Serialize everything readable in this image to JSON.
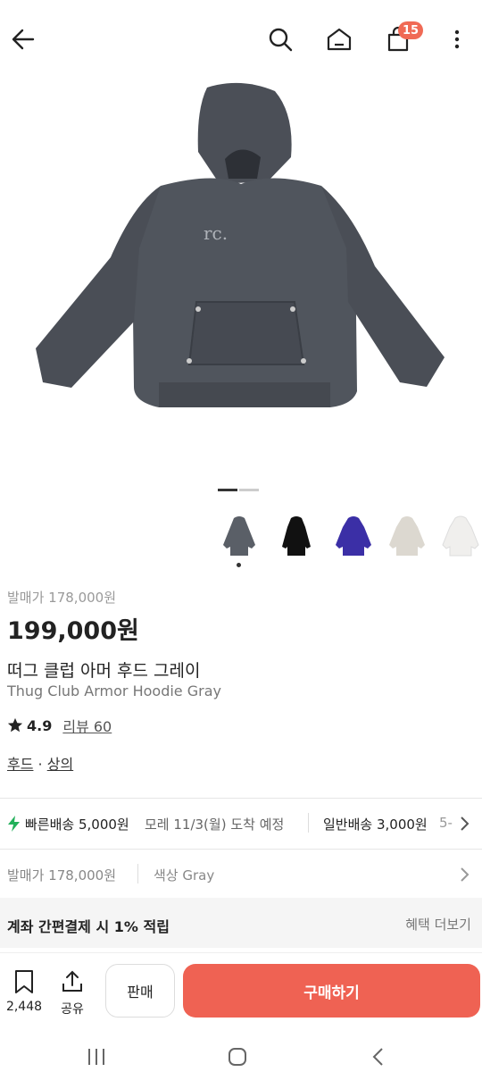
{
  "header": {
    "back_icon": "arrow-left-icon",
    "search_icon": "search-icon",
    "home_icon": "home-icon",
    "cart_icon": "shopping-bag-icon",
    "cart_count": "15",
    "more_icon": "more-vertical-icon",
    "badge_color": "#f06a55"
  },
  "gallery": {
    "thumbnails": [
      "gray-hoodie",
      "black-hoodie",
      "purple-hoodie",
      "beige-hoodie",
      "white-hoodie"
    ]
  },
  "product": {
    "release_price": "발매가 178,000원",
    "price": "199,000원",
    "name_ko": "떠그 클럽 아머 후드 그레이",
    "name_en": "Thug Club Armor Hoodie Gray",
    "rating": "4.9",
    "review_link": "리뷰 60",
    "category_1": "후드",
    "category_sep": "·",
    "category_2": "상의"
  },
  "shipping": {
    "fast_label": "빠른배송 5,000원",
    "fast_eta": "모레 11/3(월) 도착 예정",
    "normal_label": "일반배송 3,000원",
    "normal_eta": "5-"
  },
  "info": {
    "release_price": "발매가 178,000원",
    "color": "색상 Gray"
  },
  "promo": {
    "text": "계좌 간편결제 시 1% 적립",
    "link": "혜택 더보기"
  },
  "actions": {
    "wishlist_count": "2,448",
    "share_label": "공유",
    "sell_label": "판매",
    "buy_label": "구매하기",
    "buy_color": "#ef6253"
  }
}
